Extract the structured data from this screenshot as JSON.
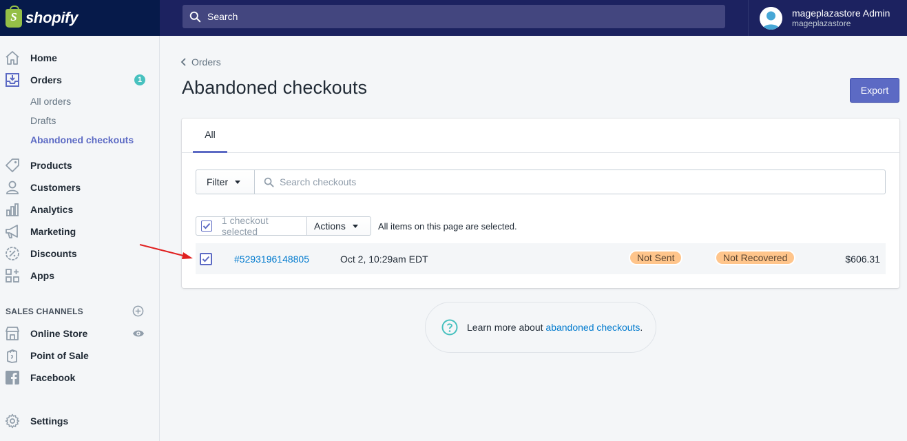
{
  "topbar": {
    "logo_text": "shopify",
    "logo_glyph": "S",
    "search_placeholder": "Search",
    "user_name": "mageplazastore Admin",
    "user_store": "mageplazastore"
  },
  "sidebar": {
    "items": [
      {
        "label": "Home",
        "icon": "home-icon"
      },
      {
        "label": "Orders",
        "icon": "orders-icon",
        "badge": "1"
      },
      {
        "label": "Products",
        "icon": "tag-icon"
      },
      {
        "label": "Customers",
        "icon": "customer-icon"
      },
      {
        "label": "Analytics",
        "icon": "analytics-icon"
      },
      {
        "label": "Marketing",
        "icon": "megaphone-icon"
      },
      {
        "label": "Discounts",
        "icon": "discount-icon"
      },
      {
        "label": "Apps",
        "icon": "apps-icon"
      }
    ],
    "order_subitems": [
      "All orders",
      "Drafts",
      "Abandoned checkouts"
    ],
    "sales_channels_title": "SALES CHANNELS",
    "channels": [
      {
        "label": "Online Store",
        "icon": "store-icon"
      },
      {
        "label": "Point of Sale",
        "icon": "pos-icon"
      },
      {
        "label": "Facebook",
        "icon": "facebook-icon"
      }
    ],
    "settings_label": "Settings"
  },
  "main": {
    "breadcrumb": "Orders",
    "title": "Abandoned checkouts",
    "export_label": "Export",
    "tab_all": "All",
    "filter_label": "Filter",
    "search_placeholder": "Search checkouts",
    "bulk": {
      "selected_text": "1 checkout selected",
      "actions_label": "Actions",
      "note": "All items on this page are selected."
    },
    "rows": [
      {
        "id": "#5293196148805",
        "date": "Oct 2, 10:29am EDT",
        "email_status": "Not Sent",
        "recovery_status": "Not Recovered",
        "total": "$606.31",
        "selected": true
      }
    ],
    "learn_more_prefix": "Learn more about ",
    "learn_more_link": "abandoned checkouts",
    "learn_more_suffix": "."
  },
  "colors": {
    "topbar": "#1c2260",
    "accent": "#5c6ac4",
    "link": "#007ace",
    "badge": "#47c1bf",
    "pill": "#ffc58b",
    "annotation_arrow": "#e02020"
  }
}
